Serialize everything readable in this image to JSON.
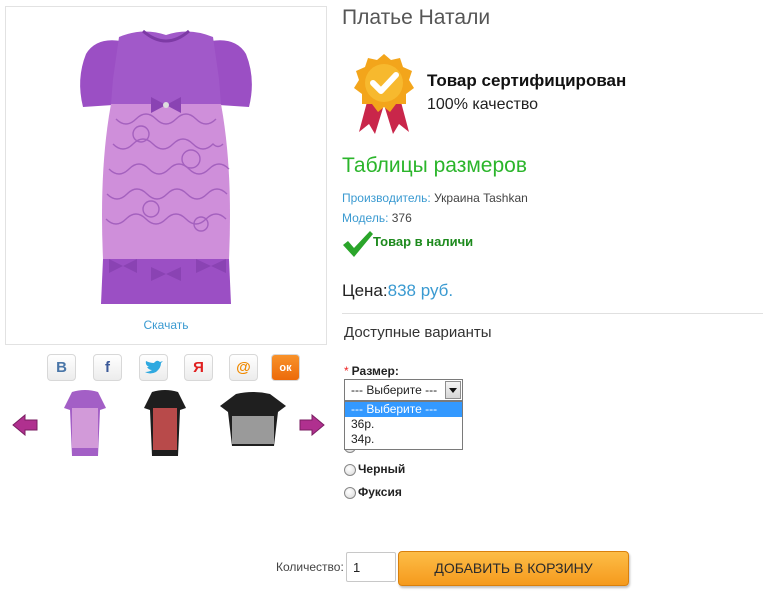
{
  "product": {
    "title": "Платье Натали",
    "download_label": "Скачать"
  },
  "certificate": {
    "title": "Товар сертифицирован",
    "subtitle": "100% качество"
  },
  "size_table_link": "Таблицы размеров",
  "manufacturer": {
    "label": "Производитель:",
    "value": " Украина Tashkan"
  },
  "model": {
    "label": "Модель:",
    "value": " 376"
  },
  "stock_status": "Товар в наличи",
  "price": {
    "label": "Цена:",
    "value": "838 руб."
  },
  "options": {
    "title": "Доступные варианты",
    "size": {
      "required_mark": "*",
      "label": "Размер:",
      "selected": "--- Выберите ---",
      "dropdown_options": [
        "--- Выберите ---",
        "36р.",
        "34р."
      ]
    },
    "colors": [
      "Черный",
      "Фуксия"
    ]
  },
  "share_buttons": [
    {
      "name": "vkontakte",
      "glyph": "B",
      "color": "#4a76a8"
    },
    {
      "name": "facebook",
      "glyph": "f",
      "color": "#3b5998"
    },
    {
      "name": "twitter",
      "glyph": "t",
      "color": "#2fa9e0"
    },
    {
      "name": "moikrug",
      "glyph": "Я",
      "color": "#e02020"
    },
    {
      "name": "mailru",
      "glyph": "@",
      "color": "#f08a00"
    },
    {
      "name": "odnoklassniki",
      "glyph": "ок",
      "color": "#f2720c"
    }
  ],
  "thumbnails": [
    {
      "name": "purple-dress",
      "color": "#a35fc6"
    },
    {
      "name": "black-red-dress",
      "color": "#a33b3b"
    },
    {
      "name": "black-grey-dress",
      "color": "#2d2d2d"
    }
  ],
  "quantity": {
    "label": "Количество:",
    "value": "1"
  },
  "add_to_cart_label": "ДОБАВИТЬ В КОРЗИНУ",
  "colors": {
    "link_blue": "#3a9ad1",
    "green": "#2bb52b",
    "cart_orange": "#f59a1d",
    "select_highlight": "#3399ff"
  }
}
